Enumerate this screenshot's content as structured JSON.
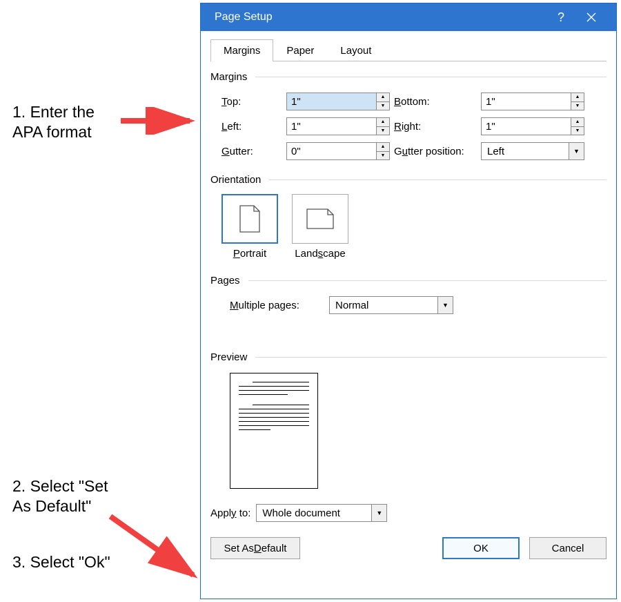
{
  "annotations": {
    "step1": "1. Enter the\nAPA format",
    "step2": "2. Select \"Set\nAs Default\"",
    "step3": "3. Select \"Ok\""
  },
  "dialog": {
    "title": "Page Setup",
    "tabs": {
      "margins": "Margins",
      "paper": "Paper",
      "layout": "Layout"
    },
    "groups": {
      "margins": "Margins",
      "orientation": "Orientation",
      "pages": "Pages",
      "preview": "Preview"
    },
    "margins": {
      "top_label": "Top:",
      "top_value": "1\"",
      "bottom_label": "Bottom:",
      "bottom_value": "1\"",
      "left_label": "Left:",
      "left_value": "1\"",
      "right_label": "Right:",
      "right_value": "1\"",
      "gutter_label": "Gutter:",
      "gutter_value": "0\"",
      "gutterpos_label": "Gutter position:",
      "gutterpos_value": "Left"
    },
    "orientation": {
      "portrait": "Portrait",
      "landscape": "Landscape"
    },
    "pages": {
      "multiple_label": "Multiple pages:",
      "multiple_value": "Normal"
    },
    "applyto": {
      "label": "Apply to:",
      "value": "Whole document"
    },
    "buttons": {
      "set_default": "Set As Default",
      "ok": "OK",
      "cancel": "Cancel"
    }
  }
}
